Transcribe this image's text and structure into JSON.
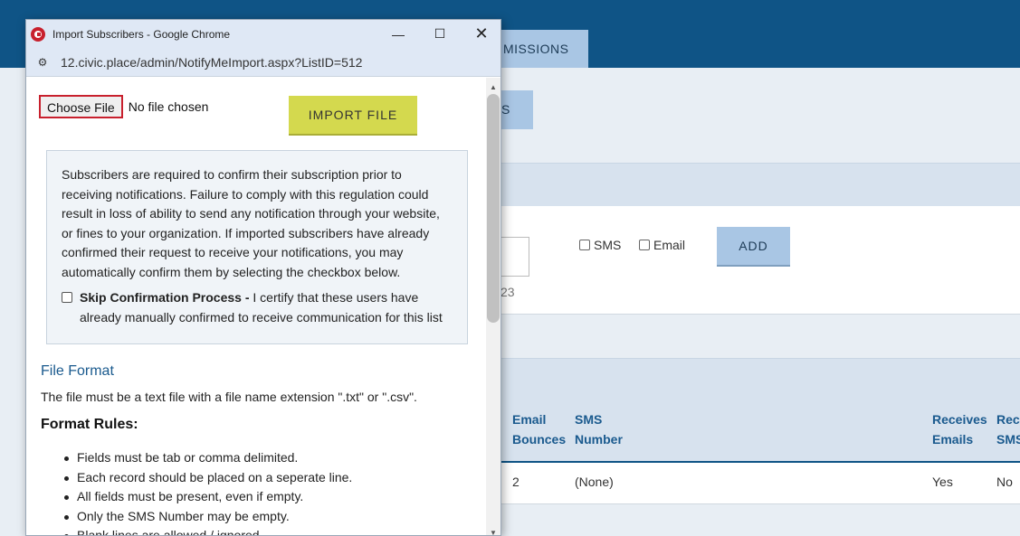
{
  "background": {
    "tab_label": "MISSIONS",
    "top_button_label": "S",
    "hint_text": "23",
    "checkboxes": [
      {
        "label": "SMS"
      },
      {
        "label": "Email"
      }
    ],
    "add_label": "ADD",
    "columns": {
      "email_bounces": [
        "Email",
        "Bounces"
      ],
      "sms_number": [
        "SMS",
        "Number"
      ],
      "receives_emails": [
        "Receives",
        "Emails"
      ],
      "receives_sms": [
        "Rec",
        "SMS"
      ]
    },
    "row": {
      "email_bounces": "2",
      "sms_number": "(None)",
      "receives_emails": "Yes",
      "receives_sms": "No"
    }
  },
  "popup": {
    "window_title": "Import Subscribers - Google Chrome",
    "url": "12.civic.place/admin/NotifyMeImport.aspx?ListID=512",
    "choose_file_label": "Choose File",
    "no_file_text": "No file chosen",
    "import_label": "IMPORT FILE",
    "notice_text": "Subscribers are required to confirm their subscription prior to receiving notifications. Failure to comply with this regulation could result in loss of ability to send any notification through your website, or fines to your organization. If imported subscribers have already confirmed their request to receive your notifications, you may automatically confirm them by selecting the checkbox below.",
    "skip_title": "Skip Confirmation Process -",
    "skip_text": " I certify that these users have already manually confirmed to receive communication for this list",
    "file_format_title": "File Format",
    "file_format_desc": "The file must be a text file with a file name extension \".txt\" or \".csv\".",
    "format_rules_title": "Format Rules:",
    "rules": [
      "Fields must be tab or comma delimited.",
      "Each record should be placed on a seperate line.",
      "All fields must be present, even if empty.",
      "Only the SMS Number may be empty.",
      "Blank lines are allowed / ignored."
    ]
  }
}
